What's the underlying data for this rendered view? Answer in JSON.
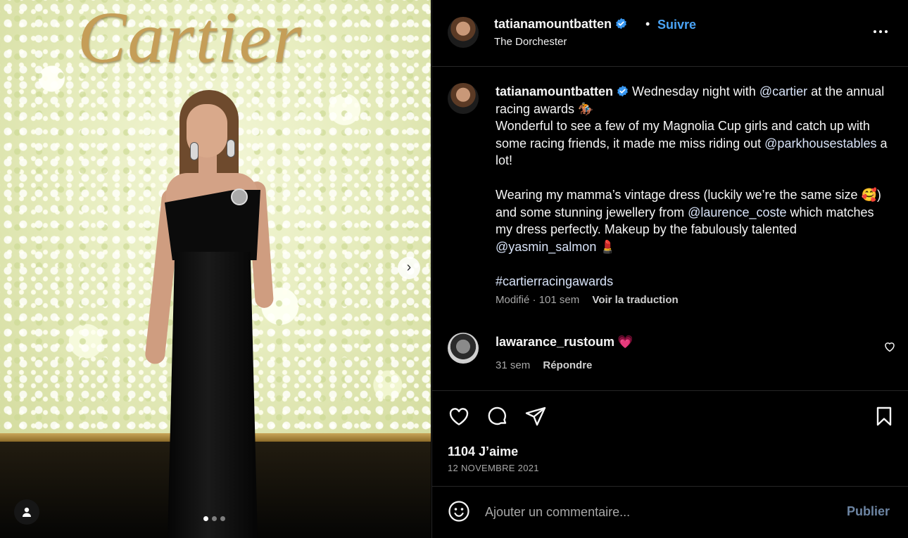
{
  "photo": {
    "brand_text": "Cartier",
    "carousel": {
      "current": 1,
      "total": 3
    },
    "icons": {
      "next": "chevron-right-icon",
      "tagged_users": "user-icon"
    }
  },
  "header": {
    "username": "tatianamountbatten",
    "verified": true,
    "separator": "•",
    "follow_label": "Suivre",
    "location": "The Dorchester",
    "more_icon": "more-horizontal-icon"
  },
  "caption": {
    "username": "tatianamountbatten",
    "p1_a": "Wednesday night with ",
    "p1_mention": "@cartier",
    "p1_b": " at the annual racing awards 🏇",
    "p2_a": "Wonderful to see a few of my Magnolia Cup girls and catch up with some racing friends, it made me miss riding out ",
    "p2_mention": "@parkhousestables",
    "p2_b": " a lot!",
    "p3_a": "Wearing my mamma’s vintage dress (luckily we’re the same size 🥰) and some stunning jewellery from ",
    "p3_mention1": "@laurence_coste",
    "p3_b": " which matches my dress perfectly. Makeup by the fabulously talented ",
    "p3_mention2": "@yasmin_salmon",
    "p3_c": " 💄",
    "hashtag": "#cartierracingawards",
    "edited": "Modifié",
    "time": "101 sem",
    "translate_label": "Voir la traduction"
  },
  "comment": {
    "username": "lawarance_rustoum",
    "text": "💗",
    "time": "31 sem",
    "reply_label": "Répondre"
  },
  "actions": {
    "likes": "1104 J’aime",
    "date": "12 NOVEMBRE 2021"
  },
  "add_comment": {
    "placeholder": "Ajouter un commentaire...",
    "publish_label": "Publier"
  },
  "colors": {
    "background": "#000000",
    "link_blue": "#4aa3f5",
    "muted": "#a8a8a8",
    "publish_disabled": "#6d85a3",
    "divider": "#262626"
  }
}
